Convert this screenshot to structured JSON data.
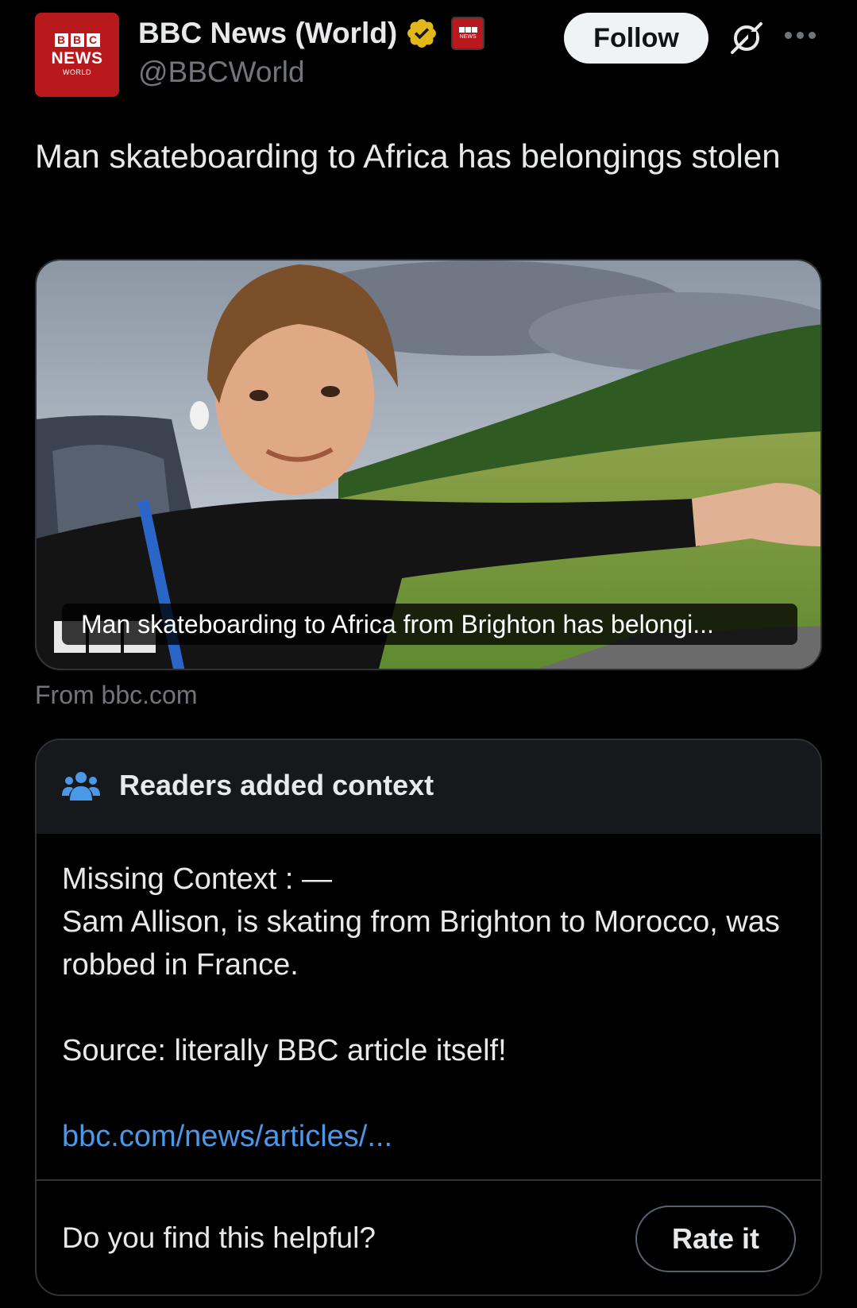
{
  "account": {
    "display_name": "BBC News (World)",
    "handle": "@BBCWorld",
    "avatar_text": {
      "blocks": [
        "B",
        "B",
        "C"
      ],
      "line1": "NEWS",
      "line2": "WORLD"
    },
    "verified_icon": "gold-verified-badge-icon",
    "affiliate_badge_icon": "bbc-news-affiliate-icon"
  },
  "actions": {
    "follow_label": "Follow",
    "grok_icon": "grok-icon",
    "more_icon": "more-options-icon"
  },
  "tweet": {
    "text": "Man skateboarding to Africa has belongings stolen"
  },
  "media": {
    "caption": "Man skateboarding to Africa from Brighton has belongi...",
    "source": "From bbc.com"
  },
  "community_note": {
    "header": "Readers added context",
    "header_icon": "people-icon",
    "body_line1": "Missing Context : —",
    "body_line2": "Sam Allison, is skating from Brighton to Morocco, was robbed in France.",
    "body_line3": "Source: literally BBC article itself!",
    "link": "bbc.com/news/articles/...",
    "helpful_question": "Do you find this helpful?",
    "rate_label": "Rate it"
  },
  "colors": {
    "background": "#000000",
    "text_primary": "#e7e9ea",
    "text_secondary": "#71767b",
    "link": "#4a99e9",
    "bbc_red": "#b8191c",
    "note_header_bg": "#16181c",
    "border": "#2f3336"
  }
}
